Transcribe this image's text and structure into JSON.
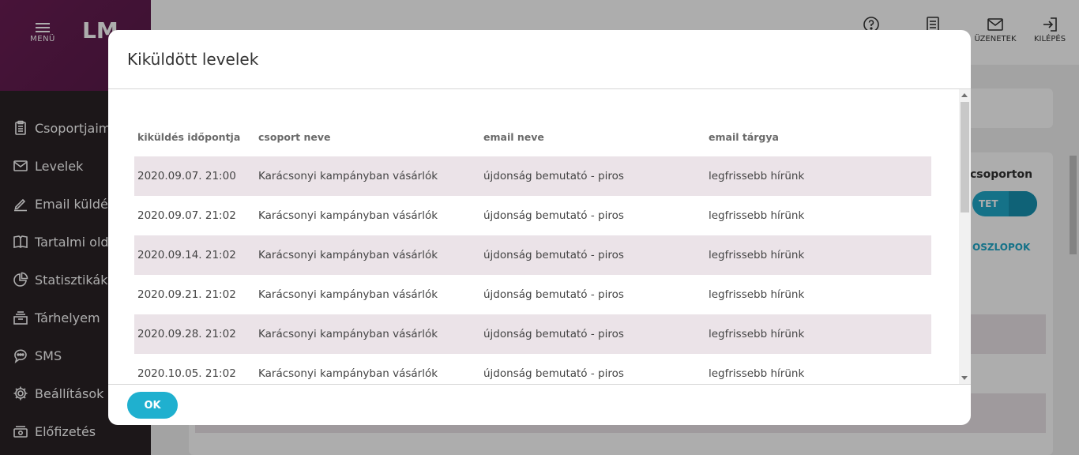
{
  "app": {
    "menu_label": "MENÜ",
    "logo_text": "LM"
  },
  "sidebar": {
    "items": [
      {
        "label": "Csoportjaim",
        "icon": "clipboard-icon"
      },
      {
        "label": "Levelek",
        "icon": "envelope-icon"
      },
      {
        "label": "Email küldés",
        "icon": "pencil-icon"
      },
      {
        "label": "Tartalmi oldalak",
        "icon": "book-icon"
      },
      {
        "label": "Statisztikák",
        "icon": "pie-chart-icon"
      },
      {
        "label": "Tárhelyem",
        "icon": "storage-icon"
      },
      {
        "label": "SMS",
        "icon": "chat-bubble-icon"
      },
      {
        "label": "Beállítások",
        "icon": "gear-icon"
      },
      {
        "label": "Előfizetés",
        "icon": "money-icon"
      }
    ]
  },
  "topbar": {
    "help_icon": "help-icon",
    "list_icon": "list-icon",
    "messages_label": "ÜZENETEK",
    "logout_label": "KILÉPÉS"
  },
  "background": {
    "card_title": "csoporton",
    "button_label": "TET",
    "columns_link": "OSZLOPOK"
  },
  "modal": {
    "title": "Kiküldött levelek",
    "columns": [
      "kiküldés időpontja",
      "csoport neve",
      "email neve",
      "email tárgya"
    ],
    "rows": [
      [
        "2020.09.07. 21:00",
        "Karácsonyi kampányban vásárlók",
        "újdonság bemutató - piros",
        "legfrissebb hírünk"
      ],
      [
        "2020.09.07. 21:02",
        "Karácsonyi kampányban vásárlók",
        "újdonság bemutató - piros",
        "legfrissebb hírünk"
      ],
      [
        "2020.09.14. 21:02",
        "Karácsonyi kampányban vásárlók",
        "újdonság bemutató - piros",
        "legfrissebb hírünk"
      ],
      [
        "2020.09.21. 21:02",
        "Karácsonyi kampányban vásárlók",
        "újdonság bemutató - piros",
        "legfrissebb hírünk"
      ],
      [
        "2020.09.28. 21:02",
        "Karácsonyi kampányban vásárlók",
        "újdonság bemutató - piros",
        "legfrissebb hírünk"
      ],
      [
        "2020.10.05. 21:02",
        "Karácsonyi kampányban vásárlók",
        "újdonság bemutató - piros",
        "legfrissebb hírünk"
      ]
    ],
    "ok_label": "OK"
  },
  "colors": {
    "accent": "#1fb0cf",
    "row_shade": "#ebe3e8",
    "sidebar_bg": "#2a2226",
    "brand_purple": "#6a1d54"
  }
}
